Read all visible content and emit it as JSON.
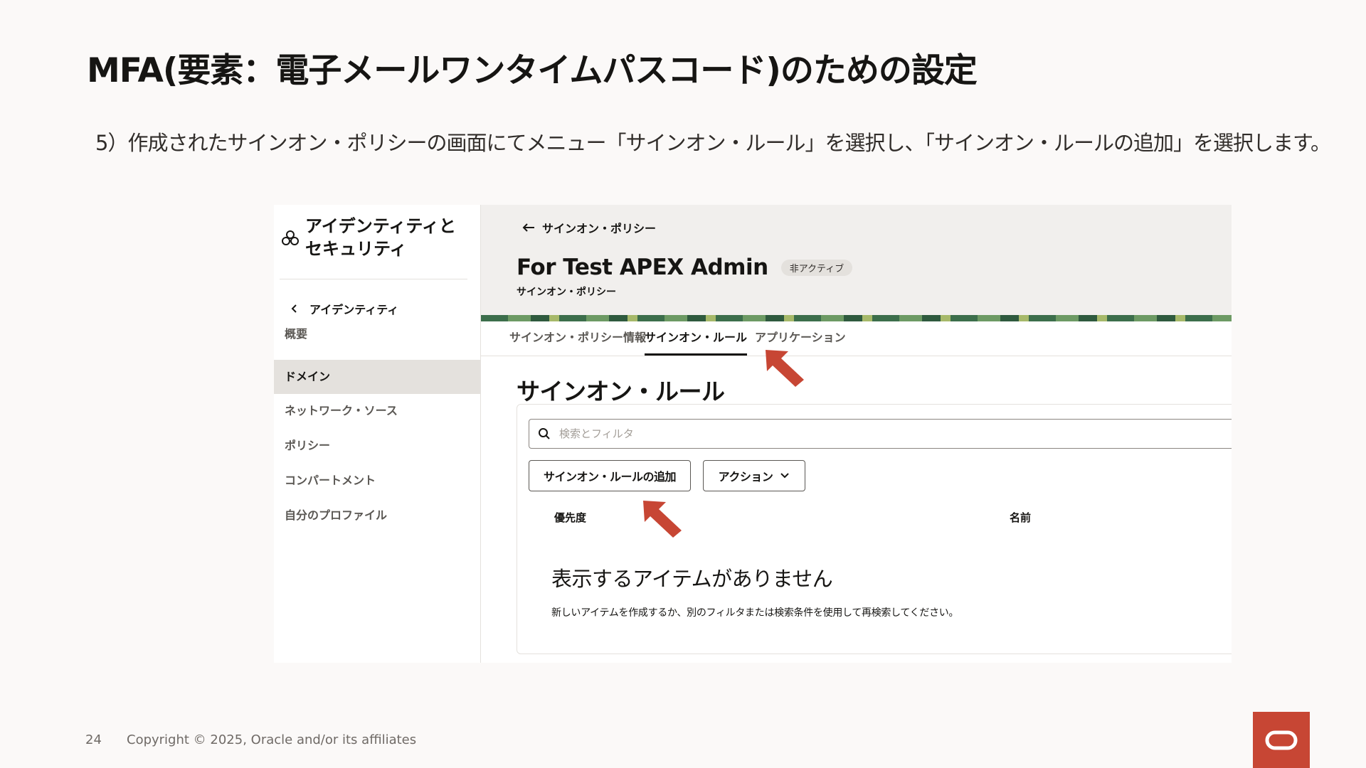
{
  "slide": {
    "title": "MFA(要素：電子メールワンタイムパスコード)のための設定",
    "instruction": "5）作成されたサインオン・ポリシーの画面にてメニュー「サインオン・ルール」を選択し、「サインオン・ルールの追加」を選択します。",
    "page_number": "24",
    "copyright": "Copyright © 2025, Oracle and/or its affiliates"
  },
  "sidebar": {
    "title_line1": "アイデンティティと",
    "title_line2": "セキュリティ",
    "back_label": "アイデンティティ",
    "items": [
      {
        "label": "概要"
      },
      {
        "label": "ドメイン",
        "active": true
      },
      {
        "label": "ネットワーク・ソース"
      },
      {
        "label": "ポリシー"
      },
      {
        "label": "コンパートメント"
      },
      {
        "label": "自分のプロファイル"
      }
    ]
  },
  "header": {
    "breadcrumb": "サインオン・ポリシー",
    "title": "For Test APEX Admin",
    "status_badge": "非アクティブ",
    "subtitle": "サインオン・ポリシー"
  },
  "tabs": [
    {
      "label": "サインオン・ポリシー情報"
    },
    {
      "label": "サインオン・ルール",
      "active": true
    },
    {
      "label": "アプリケーション"
    }
  ],
  "content": {
    "section_title": "サインオン・ルール",
    "search_placeholder": "検索とフィルタ",
    "add_rule_button": "サインオン・ルールの追加",
    "actions_button": "アクション",
    "columns": [
      "優先度",
      "名前"
    ],
    "empty_title": "表示するアイテムがありません",
    "empty_desc": "新しいアイテムを作成するか、別のフィルタまたは検索条件を使用して再検索してください。"
  },
  "colors": {
    "accent_red": "#c74634",
    "active_bg": "#e4e1dd"
  }
}
